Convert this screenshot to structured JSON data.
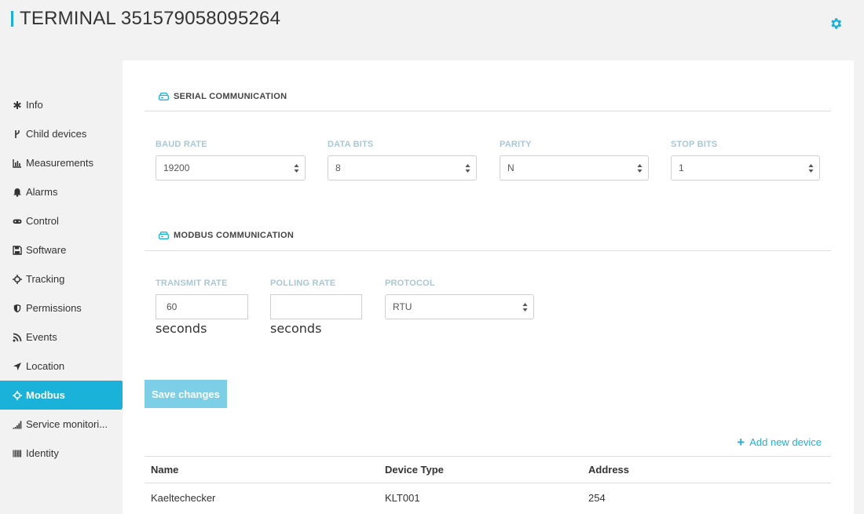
{
  "header": {
    "title": "TERMINAL 351579058095264",
    "settings_icon": "gear-icon",
    "accent_color": "#1ab2d8"
  },
  "sidebar": {
    "items": [
      {
        "label": "Info",
        "icon": "asterisk-icon"
      },
      {
        "label": "Child devices",
        "icon": "fork-icon"
      },
      {
        "label": "Measurements",
        "icon": "bar-chart-icon"
      },
      {
        "label": "Alarms",
        "icon": "bell-icon"
      },
      {
        "label": "Control",
        "icon": "gamepad-icon"
      },
      {
        "label": "Software",
        "icon": "floppy-icon"
      },
      {
        "label": "Tracking",
        "icon": "crosshair-icon"
      },
      {
        "label": "Permissions",
        "icon": "shield-icon"
      },
      {
        "label": "Events",
        "icon": "rss-icon"
      },
      {
        "label": "Location",
        "icon": "location-arrow-icon"
      },
      {
        "label": "Modbus",
        "icon": "crosshair-icon",
        "active": true
      },
      {
        "label": "Service monitori...",
        "icon": "signal-icon"
      },
      {
        "label": "Identity",
        "icon": "barcode-icon"
      }
    ]
  },
  "serial": {
    "title": "SERIAL COMMUNICATION",
    "baud_rate": {
      "label": "BAUD RATE",
      "value": "19200"
    },
    "data_bits": {
      "label": "DATA BITS",
      "value": "8"
    },
    "parity": {
      "label": "PARITY",
      "value": "N"
    },
    "stop_bits": {
      "label": "STOP BITS",
      "value": "1"
    }
  },
  "modbus": {
    "title": "MODBUS COMMUNICATION",
    "transmit_rate": {
      "label": "TRANSMIT RATE",
      "value": "60",
      "unit": "seconds"
    },
    "polling_rate": {
      "label": "POLLING RATE",
      "value": "",
      "unit": "seconds"
    },
    "protocol": {
      "label": "PROTOCOL",
      "value": "RTU"
    }
  },
  "actions": {
    "save_label": "Save changes",
    "add_device_label": "Add new device"
  },
  "devices_table": {
    "columns": [
      "Name",
      "Device Type",
      "Address"
    ],
    "rows": [
      [
        "Kaeltechecker",
        "KLT001",
        "254"
      ]
    ]
  }
}
